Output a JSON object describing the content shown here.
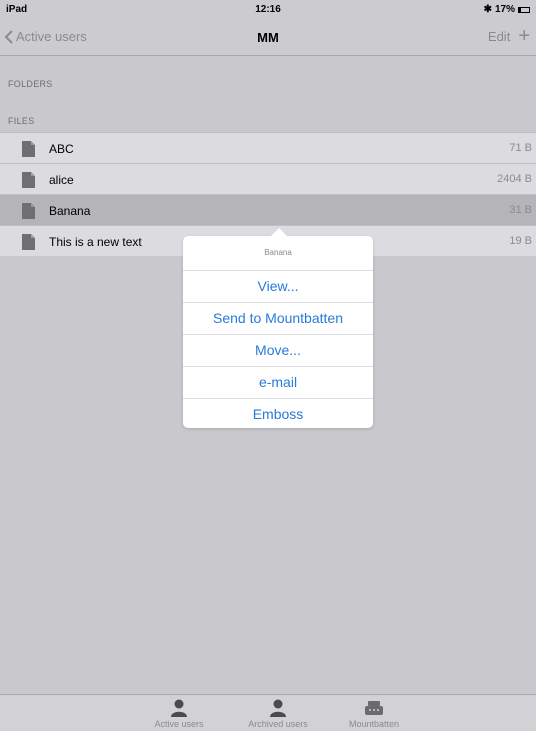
{
  "status": {
    "device": "iPad",
    "time": "12:16",
    "battery": "17%",
    "bluetooth_icon": "bluetooth-icon"
  },
  "nav": {
    "back_label": "Active users",
    "title": "MM",
    "edit_label": "Edit",
    "add_label": "+"
  },
  "sections": {
    "folders": "FOLDERS",
    "files": "FILES"
  },
  "files": [
    {
      "name": "ABC",
      "size": "71 B"
    },
    {
      "name": "alice",
      "size": "2404 B"
    },
    {
      "name": "Banana",
      "size": "31 B"
    },
    {
      "name": "This is a new text",
      "size": "19 B"
    }
  ],
  "selected_file_index": 2,
  "popover": {
    "title": "Banana",
    "items": [
      "View...",
      "Send to Mountbatten",
      "Move...",
      "e-mail",
      "Emboss"
    ]
  },
  "tabs": [
    {
      "label": "Active users",
      "icon": "person-icon"
    },
    {
      "label": "Archived users",
      "icon": "person-icon"
    },
    {
      "label": "Mountbatten",
      "icon": "brailler-icon"
    }
  ]
}
